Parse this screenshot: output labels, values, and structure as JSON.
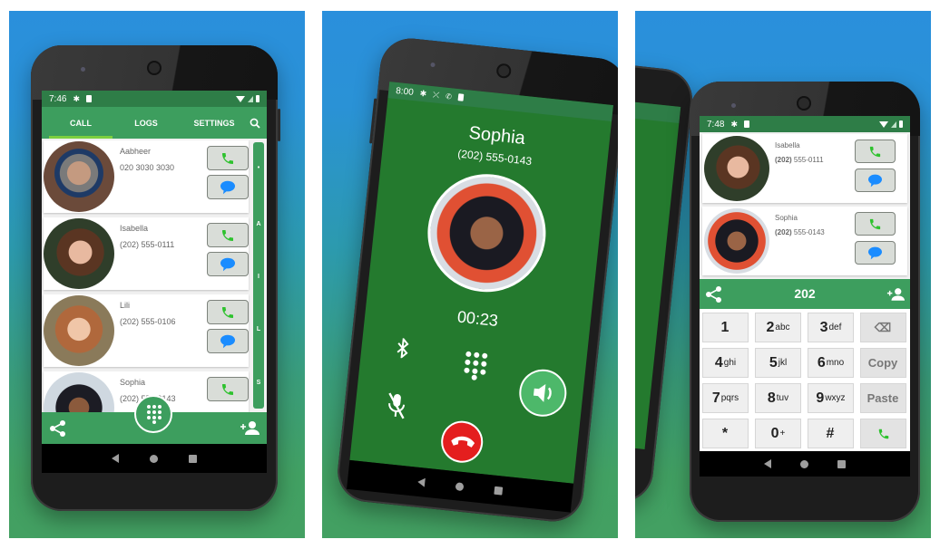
{
  "colors": {
    "primary_green": "#3d9e5e",
    "status_green": "#2e7d47",
    "incall_green": "#247a2e",
    "call_icon_green": "#2ec22e",
    "message_icon_blue": "#1a8cff",
    "hangup_red": "#e41e1e",
    "bg_top_blue": "#2a8fdc",
    "bg_bottom_green": "#43a062"
  },
  "screen1": {
    "status": {
      "time": "7:46"
    },
    "tabs": [
      {
        "label": "CALL",
        "active": true
      },
      {
        "label": "LOGS",
        "active": false
      },
      {
        "label": "SETTINGS",
        "active": false
      }
    ],
    "search_icon": "search-icon",
    "contacts": [
      {
        "name": "Aabheer",
        "number": "020 3030 3030"
      },
      {
        "name": "Isabella",
        "number": "(202) 555-0111"
      },
      {
        "name": "Lili",
        "number": "(202) 555-0106"
      },
      {
        "name": "Sophia",
        "number": "(202) 555-0143"
      }
    ],
    "index_letters": [
      "•",
      "A",
      "I",
      "L",
      "S"
    ],
    "bottom": {
      "share_icon": "share-icon",
      "dialpad_icon": "dialpad-icon",
      "add_contact_icon": "add-contact-icon"
    }
  },
  "screen2": {
    "status": {
      "time": "8:00"
    },
    "caller_name": "Sophia",
    "caller_number": "(202) 555-0143",
    "duration": "00:23",
    "controls": [
      "bluetooth",
      "dialpad",
      "speaker",
      "mute",
      "hang-up"
    ]
  },
  "screen3": {
    "status": {
      "time": "7:48"
    },
    "contacts": [
      {
        "name": "Isabella",
        "number_prefix": "(202)",
        "number_rest": " 555-0111"
      },
      {
        "name": "Sophia",
        "number_prefix": "(202)",
        "number_rest": " 555-0143"
      }
    ],
    "dialed_number": "202",
    "keys": [
      {
        "digit": "1",
        "letters": ""
      },
      {
        "digit": "2",
        "letters": "abc"
      },
      {
        "digit": "3",
        "letters": "def"
      },
      {
        "digit": "⌫",
        "letters": ""
      },
      {
        "digit": "4",
        "letters": "ghi"
      },
      {
        "digit": "5",
        "letters": "jkl"
      },
      {
        "digit": "6",
        "letters": "mno"
      },
      {
        "digit": "Copy",
        "letters": ""
      },
      {
        "digit": "7",
        "letters": "pqrs"
      },
      {
        "digit": "8",
        "letters": "tuv"
      },
      {
        "digit": "9",
        "letters": "wxyz"
      },
      {
        "digit": "Paste",
        "letters": ""
      },
      {
        "digit": "*",
        "letters": ""
      },
      {
        "digit": "0",
        "letters": "+"
      },
      {
        "digit": "#",
        "letters": ""
      }
    ]
  }
}
